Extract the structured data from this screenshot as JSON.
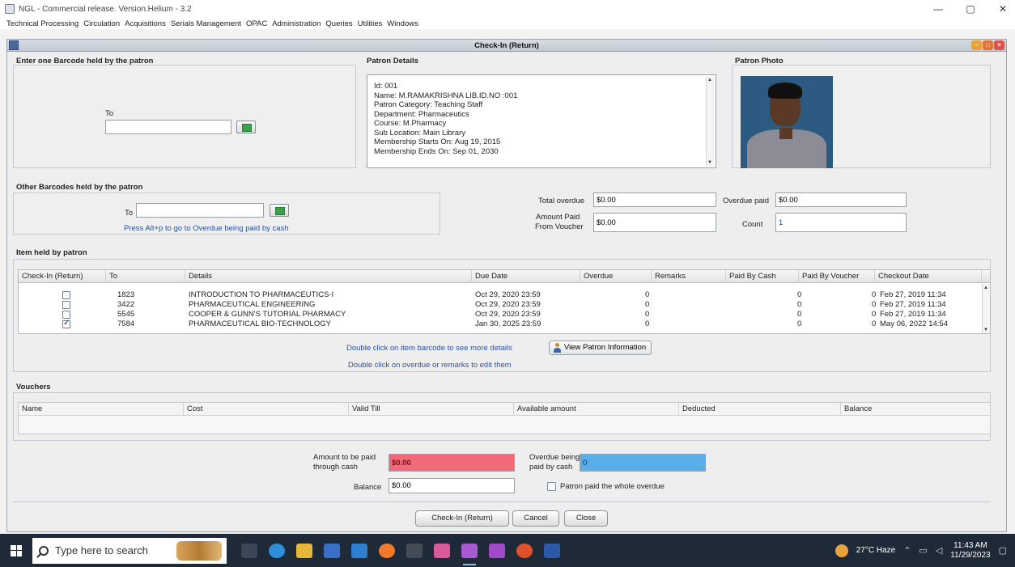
{
  "window": {
    "title": "NGL - Commercial release. Version.Helium - 3.2",
    "controls": [
      "—",
      "▢",
      "✕"
    ]
  },
  "menu": [
    "Technical Processing",
    "Circulation",
    "Acquisitions",
    "Serials Management",
    "OPAC",
    "Administration",
    "Queries",
    "Utilities",
    "Windows"
  ],
  "frame": {
    "title": "Check-In (Return)"
  },
  "barcode_section": {
    "title": "Enter one Barcode held by the patron",
    "to_label": "To",
    "value": ""
  },
  "patron_details": {
    "title": "Patron Details",
    "lines": [
      "Id: 001",
      "Name: M.RAMAKRISHNA LIB.ID.NO :001",
      "Patron Category: Teaching Staff",
      "Department: Pharmaceutics",
      "Course: M.Pharmacy",
      "Sub Location: Main Library",
      "Membership Starts On: Aug 19, 2015",
      "Membership Ends On: Sep 01, 2030"
    ]
  },
  "patron_photo": {
    "title": "Patron Photo"
  },
  "other_barcodes": {
    "title": "Other Barcodes held by the patron",
    "to_label": "To",
    "value": "",
    "hint": "Press Alt+p to go to Overdue being paid by cash"
  },
  "totals": {
    "total_overdue_label": "Total overdue",
    "total_overdue_value": "$0.00",
    "overdue_paid_label": "Overdue paid",
    "overdue_paid_value": "$0.00",
    "amount_paid_voucher_label_1": "Amount Paid",
    "amount_paid_voucher_label_2": "From Voucher",
    "amount_paid_voucher_value": "$0.00",
    "count_label": "Count",
    "count_value": "1"
  },
  "items": {
    "title": "Item held by patron",
    "columns": [
      "Check-In (Return)",
      "To",
      "Details",
      "Due Date",
      "Overdue",
      "Remarks",
      "Paid By Cash",
      "Paid By Voucher",
      "Checkout Date"
    ],
    "rows": [
      {
        "checked": false,
        "to": "1823",
        "details": "INTRODUCTION TO PHARMACEUTICS-I",
        "due": "Oct 29, 2020 23:59",
        "overdue": "0",
        "remarks": "",
        "cash": "0",
        "voucher": "0",
        "checkout": "Feb 27, 2019 11:34"
      },
      {
        "checked": false,
        "to": "3422",
        "details": "PHARMACEUTICAL ENGINEERING",
        "due": "Oct 29, 2020 23:59",
        "overdue": "0",
        "remarks": "",
        "cash": "0",
        "voucher": "0",
        "checkout": "Feb 27, 2019 11:34"
      },
      {
        "checked": false,
        "to": "5545",
        "details": "COOPER & GUNN'S TUTORIAL PHARMACY",
        "due": "Oct 29, 2020 23:59",
        "overdue": "0",
        "remarks": "",
        "cash": "0",
        "voucher": "0",
        "checkout": "Feb 27, 2019 11:34"
      },
      {
        "checked": true,
        "to": "7584",
        "details": "PHARMACEUTICAL BIO-TECHNOLOGY",
        "due": "Jan 30, 2025 23:59",
        "overdue": "0",
        "remarks": "",
        "cash": "0",
        "voucher": "0",
        "checkout": "May 06, 2022 14:54"
      }
    ],
    "hint_1": "Double click on item barcode to see more details",
    "hint_2": "Double click on overdue or remarks to edit them",
    "view_patron_button": "View Patron Information"
  },
  "vouchers": {
    "title": "Vouchers",
    "columns": [
      "Name",
      "Cost",
      "Valid Till",
      "Available amount",
      "Deducted",
      "Balance"
    ]
  },
  "payment": {
    "amount_cash_label_1": "Amount to be paid",
    "amount_cash_label_2": "through cash",
    "amount_cash_value": "$0.00",
    "overdue_cash_label_1": "Overdue being",
    "overdue_cash_label_2": "paid by cash",
    "overdue_cash_value": "0",
    "balance_label": "Balance",
    "balance_value": "$0.00",
    "paid_whole_label": "Patron paid the whole overdue",
    "amount_color": "#f26a7a",
    "overdue_color": "#5aaee8"
  },
  "buttons": {
    "checkin": "Check-In (Return)",
    "cancel": "Cancel",
    "close": "Close"
  },
  "taskbar": {
    "search_placeholder": "Type here to search",
    "weather": "27°C Haze",
    "time": "11:43 AM",
    "date": "11/29/2023"
  }
}
